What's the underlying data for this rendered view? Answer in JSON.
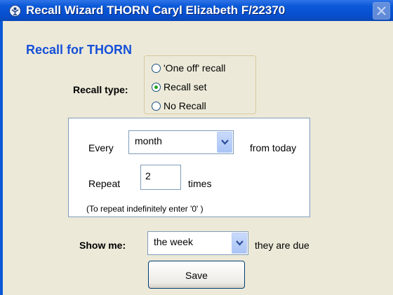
{
  "window": {
    "title": "Recall Wizard THORN Caryl Elizabeth F/22370"
  },
  "heading": "Recall for THORN",
  "recall_type": {
    "label": "Recall type:",
    "options": [
      "'One off' recall",
      "Recall set",
      "No Recall"
    ],
    "selected": "Recall set"
  },
  "recurrence": {
    "every_label": "Every",
    "interval": "month",
    "from_label": "from today",
    "repeat_label": "Repeat",
    "repeat_count": "2",
    "times_label": "times",
    "hint": "(To repeat indefinitely enter '0' )"
  },
  "show_me": {
    "label": "Show me:",
    "value": "the week",
    "suffix": "they are due"
  },
  "save_label": "Save",
  "colors": {
    "title_bar": "#0a58d8",
    "heading": "#1650d8",
    "selected_radio": "#21a121"
  },
  "icons": {
    "app": "recall-wizard-icon",
    "close": "close-icon",
    "dropdown": "chevron-down-icon"
  }
}
